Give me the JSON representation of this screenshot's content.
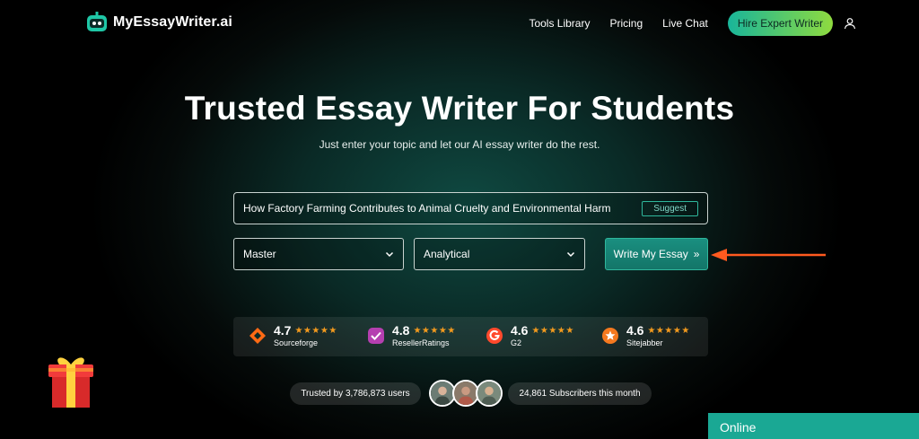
{
  "brand": {
    "name": "MyEssayWriter.ai"
  },
  "nav": {
    "links": [
      "Tools Library",
      "Pricing",
      "Live Chat"
    ],
    "cta": "Hire Expert Writer"
  },
  "hero": {
    "title": "Trusted Essay Writer For Students",
    "subtitle": "Just enter your topic and let our AI essay writer do the rest."
  },
  "form": {
    "topic_value": "How Factory Farming Contributes to Animal Cruelty and Environmental Harm",
    "suggest_label": "Suggest",
    "level_selected": "Master",
    "type_selected": "Analytical",
    "submit_label": "Write My Essay",
    "submit_glyph": "»"
  },
  "ratings": [
    {
      "score": "4.7",
      "stars": "★★★★★",
      "site": "Sourceforge",
      "icon": "sourceforge-icon"
    },
    {
      "score": "4.8",
      "stars": "★★★★★",
      "site": "ResellerRatings",
      "icon": "resellerratings-icon"
    },
    {
      "score": "4.6",
      "stars": "★★★★★",
      "site": "G2",
      "icon": "g2-icon"
    },
    {
      "score": "4.6",
      "stars": "★★★★★",
      "site": "Sitejabber",
      "icon": "sitejabber-icon"
    }
  ],
  "trust": {
    "users": "Trusted by 3,786,873 users",
    "subscribers": "24,861 Subscribers this month"
  },
  "chat": {
    "status": "Online"
  },
  "colors": {
    "accent": "#19b59a",
    "star": "#f39a1e",
    "arrow": "#ff5a1f",
    "online_bg": "#1aa894"
  }
}
